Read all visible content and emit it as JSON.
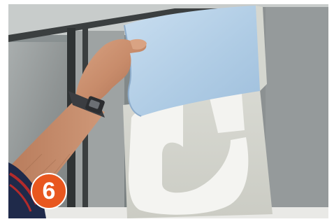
{
  "photo": {
    "scene": "hand-peeling-blue-backing-paper-from-white-vinyl-letter-on-window"
  },
  "step_badge": {
    "number": "6",
    "color": "#e8571f"
  }
}
